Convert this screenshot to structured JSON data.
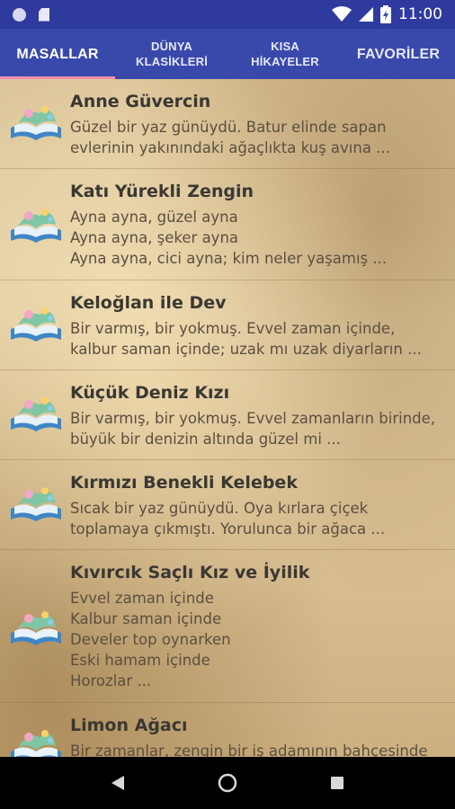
{
  "status_bar": {
    "time": "11:00",
    "icons": [
      "notification-dot-icon",
      "sd-card-icon",
      "wifi-icon",
      "signal-icon",
      "battery-icon"
    ]
  },
  "tabs": [
    {
      "label": "MASALLAR",
      "active": true
    },
    {
      "label": "DÜNYA\nKLASİKLERİ",
      "active": false
    },
    {
      "label": "KISA\nHİKAYELER",
      "active": false
    },
    {
      "label": "FAVORİLER",
      "active": false
    }
  ],
  "items": [
    {
      "title": "Anne Güvercin",
      "desc": "Güzel bir yaz günüydü. Batur elinde sapan\nevlerinin yakınındaki ağaçlıkta kuş avına ...",
      "icon": "book-icon"
    },
    {
      "title": "Katı Yürekli Zengin",
      "desc": "Ayna ayna, güzel ayna\nAyna ayna, şeker ayna\nAyna ayna, cici ayna; kim neler yaşamış ...",
      "icon": "book-icon"
    },
    {
      "title": "Keloğlan ile Dev",
      "desc": "Bir varmış, bir yokmuş. Evvel zaman içinde,\nkalbur saman içinde; uzak mı uzak diyarların ...",
      "icon": "book-icon"
    },
    {
      "title": "Küçük Deniz Kızı",
      "desc": "Bir varmış, bir yokmuş. Evvel zamanların birinde,\nbüyük bir denizin altında güzel mi ...",
      "icon": "book-icon"
    },
    {
      "title": "Kırmızı Benekli Kelebek",
      "desc": "Sıcak bir yaz günüydü. Oya kırlara çiçek\ntoplamaya çıkmıştı. Yorulunca bir ağaca ...",
      "icon": "book-icon"
    },
    {
      "title": "Kıvırcık Saçlı Kız ve İyilik",
      "desc": "Evvel zaman içinde\nKalbur saman içinde\nDeveler top oynarken\nEski hamam içinde\nHorozlar ...",
      "icon": "book-icon"
    },
    {
      "title": "Limon Ağacı",
      "desc": "Bir zamanlar, zengin bir iş adamının bahçesinde",
      "icon": "book-icon"
    }
  ],
  "nav": {
    "buttons": [
      "back-icon",
      "home-icon",
      "recents-icon"
    ]
  },
  "colors": {
    "status_bar": "#2f3a9e",
    "tab_bar": "#3949ab",
    "tab_indicator": "#f48fb1"
  }
}
